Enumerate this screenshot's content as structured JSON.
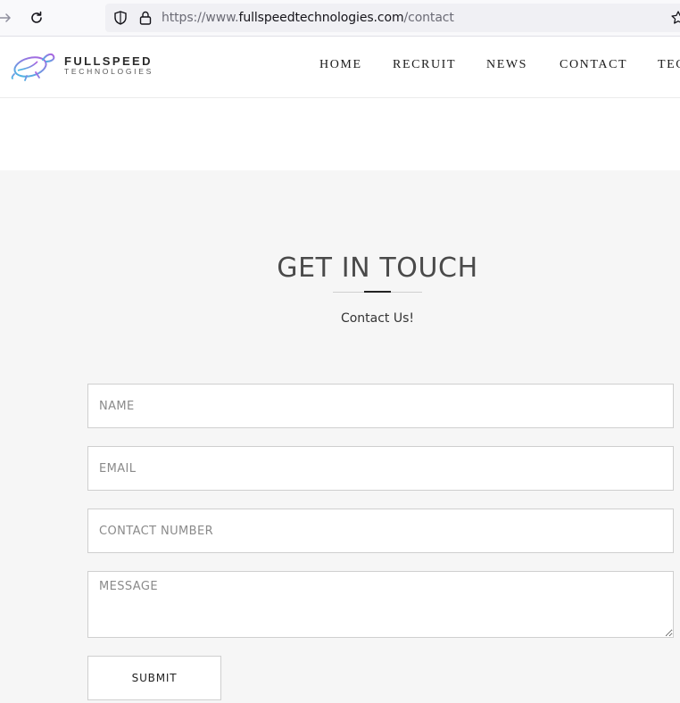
{
  "browser": {
    "url_prefix": "https://www.",
    "url_domain": "fullspeedtechnologies.com",
    "url_path": "/contact"
  },
  "site": {
    "logo_line1": "FULLSPEED",
    "logo_line2": "TECHNOLOGIES",
    "nav": [
      "HOME",
      "RECRUIT",
      "NEWS",
      "CONTACT",
      "TEC"
    ]
  },
  "contact": {
    "title": "GET IN TOUCH",
    "subtitle": "Contact Us!",
    "fields": {
      "name_placeholder": "NAME",
      "email_placeholder": "EMAIL",
      "phone_placeholder": "CONTACT NUMBER",
      "message_placeholder": "MESSAGE"
    },
    "submit_label": "SUBMIT"
  },
  "colors": {
    "page_bg": "#f6f6f6",
    "header_bg": "#ffffff",
    "text_dark": "#1a1a1a",
    "logo_gradient": [
      "#3ec1e3",
      "#b45ce0"
    ]
  }
}
